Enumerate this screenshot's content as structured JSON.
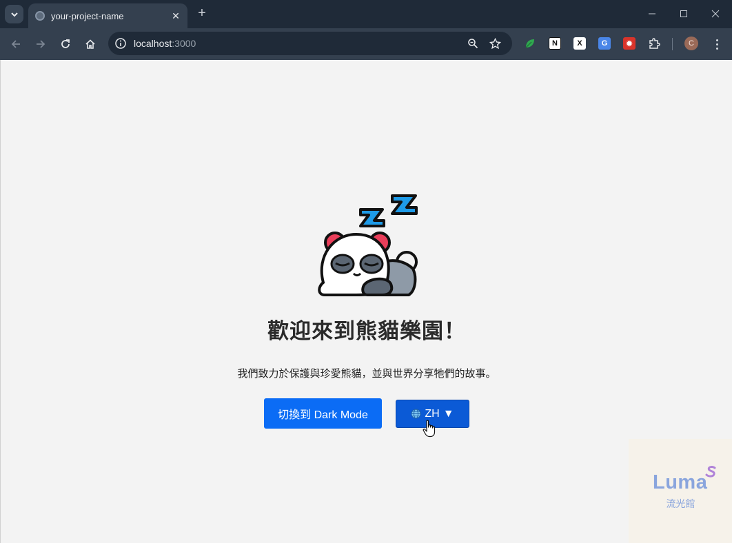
{
  "browser": {
    "tab_title": "your-project-name",
    "url_host": "localhost",
    "url_port": ":3000",
    "profile_initial": "C",
    "colors": {
      "chrome_dark": "#1f2a38",
      "chrome_toolbar": "#34404f"
    }
  },
  "page": {
    "heading": "歡迎來到熊貓樂園！",
    "intro": "我們致力於保護與珍愛熊貓，並與世界分享牠們的故事。",
    "theme_button_label": "切換到 Dark Mode",
    "language_button": {
      "label": "ZH",
      "arrow": "▼",
      "icon": "globe-icon"
    },
    "colors": {
      "primary": "#0b6cf5",
      "language_button": "#0b5ad6",
      "background": "#f3f3f3"
    }
  },
  "watermark": {
    "logo": "Luma",
    "subtitle": "流光館"
  }
}
